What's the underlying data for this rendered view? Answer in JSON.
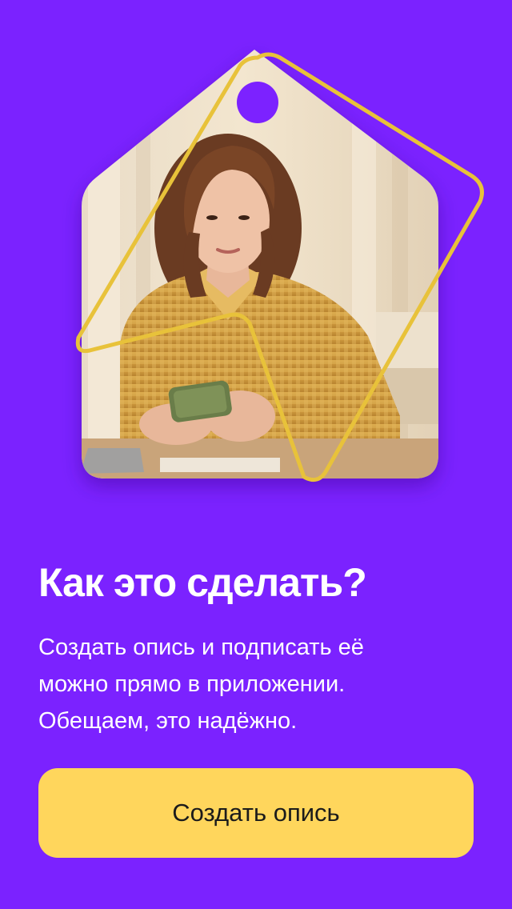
{
  "onboarding": {
    "title": "Как это сделать?",
    "description": "Создать опись и подписать её\nможно прямо в приложении.\nОбещаем, это надёжно.",
    "button_label": "Создать опись"
  },
  "colors": {
    "background": "#7b22ff",
    "accent_outline": "#e8c23a",
    "button": "#ffd65c"
  },
  "icons": {
    "hero": "price-tag-photo-illustration"
  }
}
